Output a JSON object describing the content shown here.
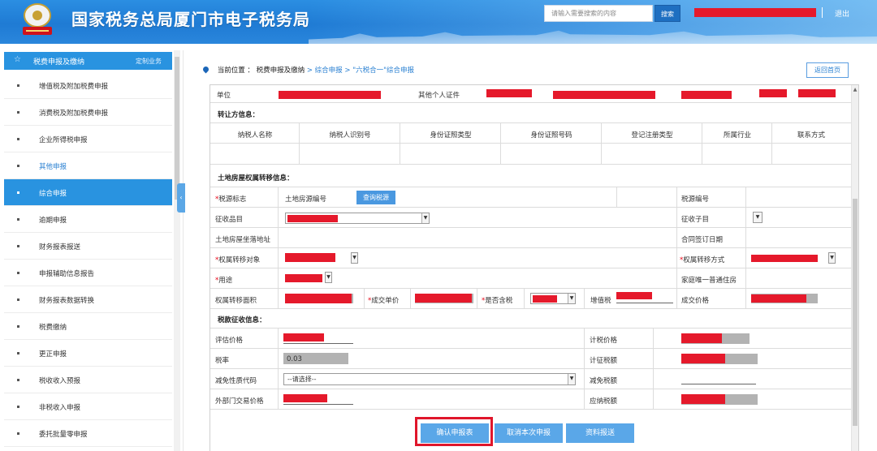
{
  "header": {
    "site_title": "国家税务总局厦门市电子税务局",
    "emblem_icon": "tax-emblem-icon",
    "search_placeholder": "请输入需要搜索的内容",
    "search_button": "搜索",
    "logout": "退出",
    "colors": {
      "bar": "#1f7bd4",
      "redaction": "#e5192b"
    }
  },
  "sidebar": {
    "heading": "税费申报及缴纳",
    "heading_link": "定制业务",
    "items": [
      {
        "label": "增值税及附加税费申报"
      },
      {
        "label": "消费税及附加税费申报"
      },
      {
        "label": "企业所得税申报"
      },
      {
        "label": "其他申报"
      },
      {
        "label": "综合申报"
      },
      {
        "label": "逾期申报"
      },
      {
        "label": "财务报表报送"
      },
      {
        "label": "申报辅助信息报告"
      },
      {
        "label": "财务报表数据转换"
      },
      {
        "label": "税费缴纳"
      },
      {
        "label": "更正申报"
      },
      {
        "label": "税收收入预报"
      },
      {
        "label": "非税收入申报"
      },
      {
        "label": "委托批量零申报"
      }
    ],
    "active_index": 4,
    "collapse_glyph": "‹"
  },
  "breadcrumb": {
    "prefix": "当前位置 ：",
    "level1": "税费申报及缴纳",
    "sep": ">",
    "level2": "综合申报",
    "sep2": ">",
    "level3": "\"六税合一\"综合申报",
    "back_button": "返回首页"
  },
  "form": {
    "top_row": {
      "label1": "单位",
      "label2": "其他个人证件"
    },
    "transferor": {
      "title": "转让方信息：",
      "columns": [
        "纳税人名称",
        "纳税人识别号",
        "身份证照类型",
        "身份证照号码",
        "登记注册类型",
        "所属行业",
        "联系方式"
      ]
    },
    "property": {
      "title": "土地房屋权属转移信息：",
      "tax_source_flag": "税源标志",
      "land_house_no": "土地房源编号",
      "query_button": "查询税源",
      "tax_source_no": "税源编号",
      "levy_item": "征收品目",
      "levy_subitem": "征收子目",
      "address": "土地房屋坐落地址",
      "contract_date": "合同签订日期",
      "transfer_object": "权属转移对象",
      "transfer_method": "权属转移方式",
      "usage": "用途",
      "family_house": "家庭唯一普通住房",
      "area": "权属转移面积",
      "unit_price": "成交单价",
      "tax_included": "是否含税",
      "vat": "增值税",
      "deal_price": "成交价格"
    },
    "levy": {
      "title": "税款征收信息：",
      "assessed_price": "评估价格",
      "tax_price": "计税价格",
      "tax_rate": "税率",
      "tax_rate_value": "0.03",
      "tax_amount": "计征税额",
      "exemption_code": "减免性质代码",
      "exemption_placeholder": "--请选择--",
      "exemption_amount": "减免税额",
      "external_price": "外部门交易价格",
      "tax_payable": "应纳税额"
    }
  },
  "buttons": {
    "confirm": "确认申报表",
    "cancel": "取消本次申报",
    "submit": "资料报送"
  }
}
